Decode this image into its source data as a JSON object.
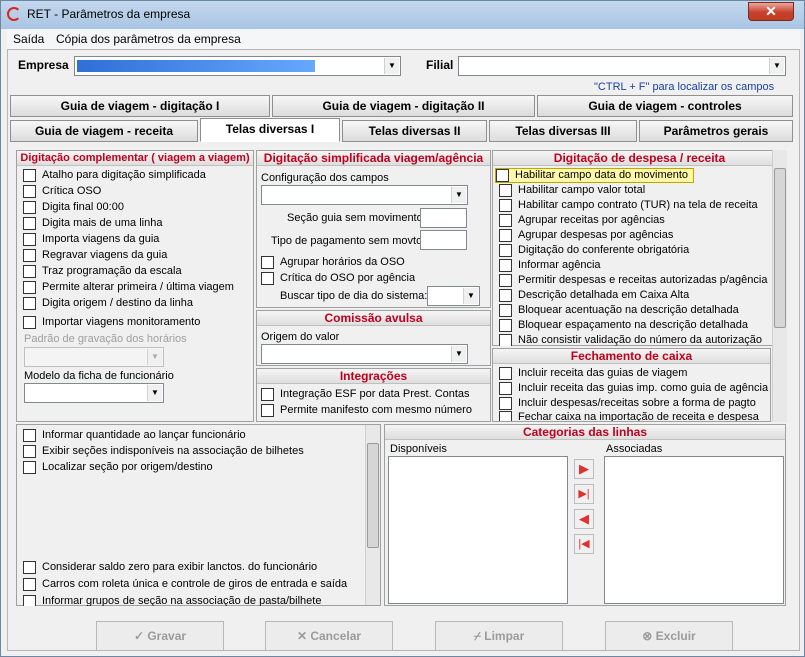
{
  "window": {
    "title": "RET - Parâmetros da empresa",
    "close": "✕"
  },
  "menu": [
    "Saída",
    "Cópia dos parâmetros da empresa"
  ],
  "header": {
    "empresa_label": "Empresa",
    "filial_label": "Filial",
    "hint": "\"CTRL + F\" para localizar os campos"
  },
  "tabs_row1": [
    "Guia de viagem - digitação I",
    "Guia de viagem - digitação II",
    "Guia de viagem - controles"
  ],
  "tabs_row2": [
    "Guia de viagem - receita",
    "Telas diversas I",
    "Telas diversas II",
    "Telas diversas III",
    "Parâmetros gerais"
  ],
  "active_tab": "Telas diversas I",
  "digit_comp": {
    "title": "Digitação complementar ( viagem a viagem)",
    "items": [
      "Atalho para digitação simplificada",
      "Crítica OSO",
      "Digita final 00:00",
      "Digita mais de uma linha",
      "Importa viagens da guia",
      "Regravar viagens da guia",
      "Traz programação da escala",
      "Permite alterar primeira / última viagem",
      "Digita origem / destino da linha",
      "Importar viagens monitoramento"
    ],
    "padrao_label": "Padrão de gravação dos horários",
    "modelo_label": "Modelo da ficha de funcionário"
  },
  "digit_simp": {
    "title": "Digitação simplificada viagem/agência",
    "config_label": "Configuração dos campos",
    "secao_label": "Seção guia sem movimento",
    "tipo_label": "Tipo de pagamento sem movto",
    "items": [
      "Agrupar horários da OSO",
      "Crítica do OSO por agência"
    ],
    "buscar_label": "Buscar tipo de dia do sistema:"
  },
  "comissao": {
    "title": "Comissão avulsa",
    "origem_label": "Origem do valor"
  },
  "integracoes": {
    "title": "Integrações",
    "items": [
      "Integração ESF por data Prest. Contas",
      "Permite manifesto com mesmo número"
    ]
  },
  "despesa": {
    "title": "Digitação de despesa / receita",
    "items": [
      "Habilitar campo data do movimento",
      "Habilitar campo valor total",
      "Habilitar campo contrato (TUR) na tela de receita",
      "Agrupar receitas por agências",
      "Agrupar despesas por agências",
      "Digitação do conferente obrigatória",
      "Informar agência",
      "Permitir despesas e receitas autorizadas p/agência",
      "Descrição detalhada em Caixa Alta",
      "Bloquear acentuação na descrição detalhada",
      "Bloquear espaçamento na descrição detalhada",
      "Não consistir validação do número da autorização"
    ]
  },
  "fechamento": {
    "title": "Fechamento de caixa",
    "items": [
      "Incluir receita das guias de viagem",
      "Incluir receita das guias imp. como guia de agência",
      "Incluir despesas/receitas sobre a forma de pagto",
      "Fechar caixa na importação de receita e despesa"
    ]
  },
  "misc": {
    "items_top": [
      "Informar quantidade ao lançar funcionário",
      "Exibir seções indisponíveis na associação de bilhetes",
      "Localizar seção por origem/destino"
    ],
    "items_bottom": [
      "Considerar saldo zero para exibir lanctos. do funcionário",
      "Carros com roleta única e controle de giros de entrada e saída",
      "Informar grupos de seção na associação de pasta/bilhete"
    ]
  },
  "categorias": {
    "title": "Categorias das linhas",
    "disponiveis": "Disponíveis",
    "associadas": "Associadas"
  },
  "buttons": {
    "gravar": "Gravar",
    "cancelar": "Cancelar",
    "limpar": "Limpar",
    "excluir": "Excluir"
  },
  "colors": {
    "section_title": "#c0001c",
    "highlight": "#fff8a6",
    "empresa_field": "#3b7fe0"
  }
}
